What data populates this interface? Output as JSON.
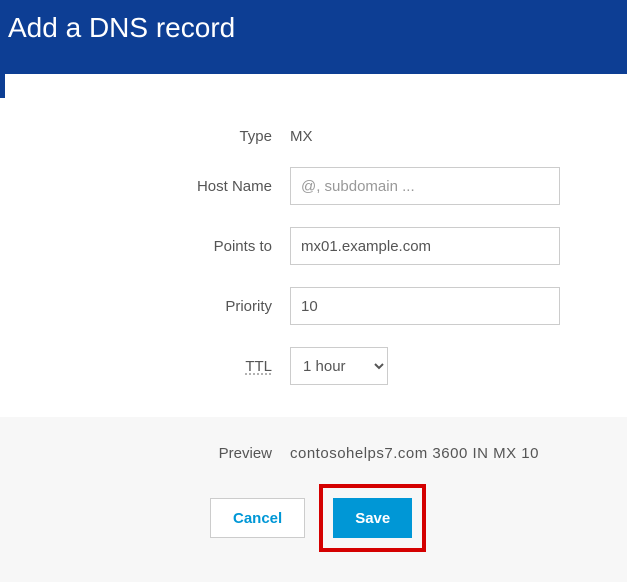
{
  "header": {
    "title": "Add a DNS record"
  },
  "form": {
    "type_label": "Type",
    "type_value": "MX",
    "hostname_label": "Host Name",
    "hostname_placeholder": "@, subdomain ...",
    "hostname_value": "",
    "pointsto_label": "Points to",
    "pointsto_value": "mx01.example.com",
    "priority_label": "Priority",
    "priority_value": "10",
    "ttl_label": "TTL",
    "ttl_value": "1 hour"
  },
  "footer": {
    "preview_label": "Preview",
    "preview_value": "contosohelps7.com  3600  IN  MX  10",
    "cancel_label": "Cancel",
    "save_label": "Save"
  }
}
